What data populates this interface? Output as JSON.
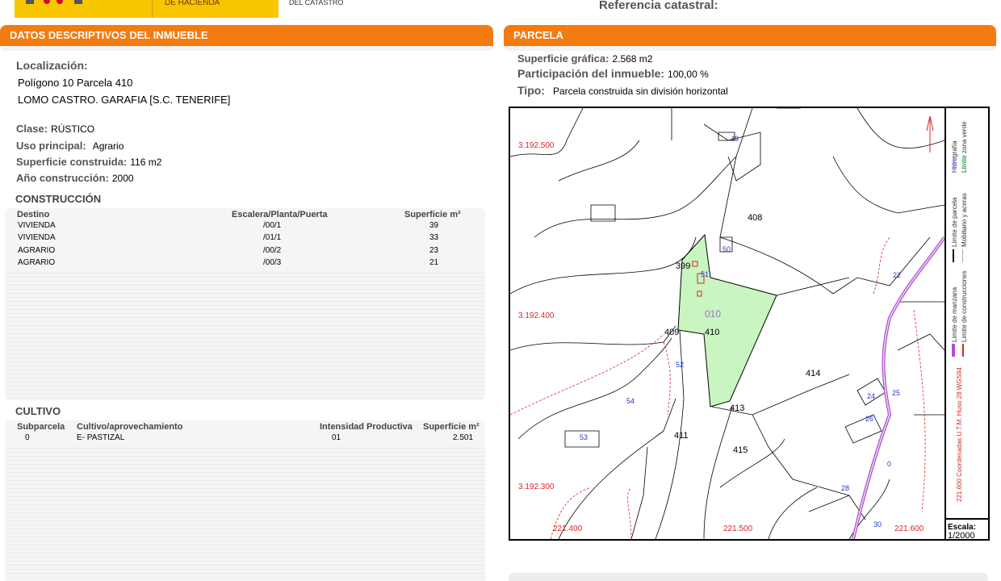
{
  "header": {
    "ministry": "DE HACIENDA",
    "direction": "DEL CATASTRO",
    "reference_label": "Referencia catastral:"
  },
  "left": {
    "title": "DATOS DESCRIPTIVOS DEL INMUEBLE",
    "localizacion_label": "Localización:",
    "localizacion_line1": "Polígono 10 Parcela 410",
    "localizacion_line2": "LOMO CASTRO. GARAFIA [S.C. TENERIFE]",
    "clase_label": "Clase:",
    "clase_value": "RÚSTICO",
    "uso_label": "Uso principal:",
    "uso_value": "Agrario",
    "sup_label": "Superficie construida:",
    "sup_value": "116 m2",
    "anio_label": "Año construcción:",
    "anio_value": "2000",
    "construccion": {
      "title": "CONSTRUCCIÓN",
      "headers": [
        "Destino",
        "Escalera/Planta/Puerta",
        "Superficie m²"
      ],
      "rows": [
        [
          "VIVIENDA",
          "/00/1",
          "39"
        ],
        [
          "VIVIENDA",
          "/01/1",
          "33"
        ],
        [
          "AGRARIO",
          "/00/2",
          "23"
        ],
        [
          "AGRARIO",
          "/00/3",
          "21"
        ]
      ]
    },
    "cultivo": {
      "title": "CULTIVO",
      "headers": [
        "Subparcela",
        "Cultivo/aprovechamiento",
        "Intensidad Productiva",
        "Superficie m²"
      ],
      "rows": [
        [
          "0",
          "E- PASTIZAL",
          "01",
          "2.501"
        ]
      ]
    }
  },
  "right": {
    "title": "PARCELA",
    "sup_grafica_label": "Superficie gráfica:",
    "sup_grafica_value": "2.568 m2",
    "participacion_label": "Participación del inmueble:",
    "participacion_value": "100,00 %",
    "tipo_label": "Tipo:",
    "tipo_value": "Parcela construida sin división horizontal"
  },
  "map": {
    "parcel_label": "010",
    "lot_labels": {
      "l408": "408",
      "l409": "409",
      "l410": "410",
      "l411": "411",
      "l413": "413",
      "l414": "414",
      "l415": "415",
      "l399": "399"
    },
    "building_labels": {
      "b49": "49",
      "b50": "50",
      "b51": "51",
      "b22": "22",
      "b52": "52",
      "b54": "54",
      "b53": "53",
      "b24": "24",
      "b25": "25",
      "b26": "26",
      "b28": "28",
      "b30": "30",
      "b0": "0"
    },
    "coord_labels": {
      "y1": "3.192.500",
      "y2": "3.192.400",
      "y3": "3.192.300",
      "x1": "221.400",
      "x2": "221.500",
      "x3": "221.600"
    },
    "legend": {
      "hidrografia": "Hidrografía",
      "zona_verde": "Límite zona verde",
      "parcela": "Límite de parcela",
      "mobiliario": "Mobiliario y aceras",
      "manzana": "Límite de manzana",
      "construcciones": "Límite de construcciones",
      "coords": "221.600 Coordenadas U.T.M. Huso 28 WGS84"
    },
    "scale_label": "Escala:",
    "scale_value": "1/2000",
    "colors": {
      "parcel_fill": "#c9f5c0",
      "coord_red": "#d8262a",
      "road_purple": "#b04fd0",
      "label_blue": "#2436c8"
    }
  }
}
